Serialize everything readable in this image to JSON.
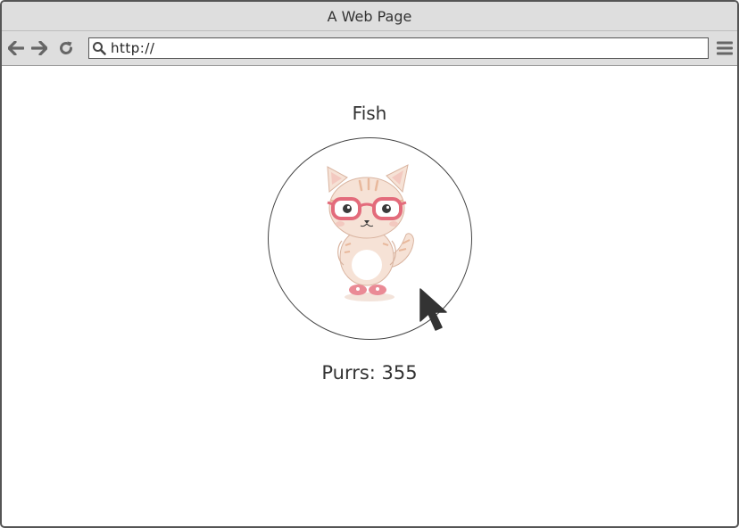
{
  "window": {
    "title": "A Web Page"
  },
  "toolbar": {
    "back_icon": "arrow-left-icon",
    "forward_icon": "arrow-right-icon",
    "reload_icon": "reload-icon",
    "address_value": "http://",
    "search_icon": "search-icon",
    "menu_icon": "hamburger-menu-icon"
  },
  "main": {
    "cat_name": "Fish",
    "counter_label": "Purrs: 355",
    "cat_image": "cat-with-pink-glasses"
  },
  "colors": {
    "chrome_bg": "#dedede",
    "glasses": "#e36b7b",
    "cat_fur": "#f6e2d6",
    "cat_stripes": "#e8b89c"
  }
}
